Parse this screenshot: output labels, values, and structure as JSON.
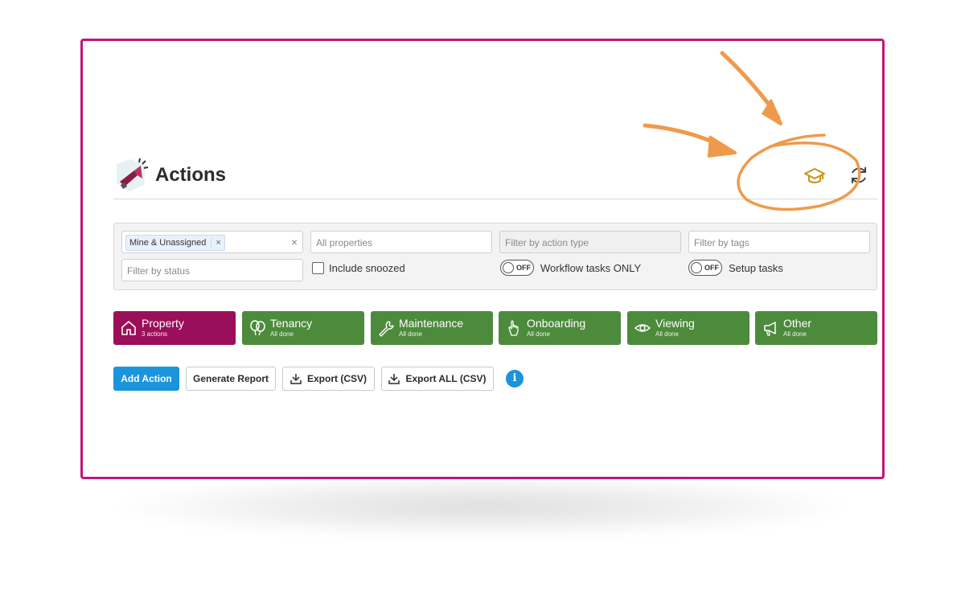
{
  "header": {
    "title": "Actions",
    "logo_icon": "megaphone-icon",
    "help_icon": "graduation-cap-icon",
    "refresh_icon": "refresh-icon"
  },
  "filters": {
    "owner_chip": "Mine & Unassigned",
    "owner_chip_remove": "×",
    "owner_clear": "×",
    "properties_placeholder": "All properties",
    "action_type_placeholder": "Filter by action type",
    "tags_placeholder": "Filter by tags",
    "status_placeholder": "Filter by status",
    "include_snoozed_label": "Include snoozed",
    "workflow_toggle_state": "OFF",
    "workflow_label": "Workflow tasks ONLY",
    "setup_toggle_state": "OFF",
    "setup_label": "Setup tasks"
  },
  "tabs": [
    {
      "label": "Property",
      "sub": "3 actions",
      "icon": "house-icon",
      "active": true
    },
    {
      "label": "Tenancy",
      "sub": "All done",
      "icon": "balloons-icon",
      "active": false
    },
    {
      "label": "Maintenance",
      "sub": "All done",
      "icon": "wrench-icon",
      "active": false
    },
    {
      "label": "Onboarding",
      "sub": "All done",
      "icon": "pointer-hand-icon",
      "active": false
    },
    {
      "label": "Viewing",
      "sub": "All done",
      "icon": "eye-icon",
      "active": false
    },
    {
      "label": "Other",
      "sub": "All done",
      "icon": "megaphone-icon",
      "active": false
    }
  ],
  "buttons": {
    "add_action": "Add Action",
    "generate_report": "Generate Report",
    "export_csv": "Export (CSV)",
    "export_all_csv": "Export ALL (CSV)",
    "info": "i"
  },
  "colors": {
    "frame": "#c0157a",
    "active_tab": "#9b0f5a",
    "tab": "#4c8b3c",
    "primary": "#1a94dc",
    "annotation": "#ef9a4a",
    "help_icon": "#c8931a"
  }
}
